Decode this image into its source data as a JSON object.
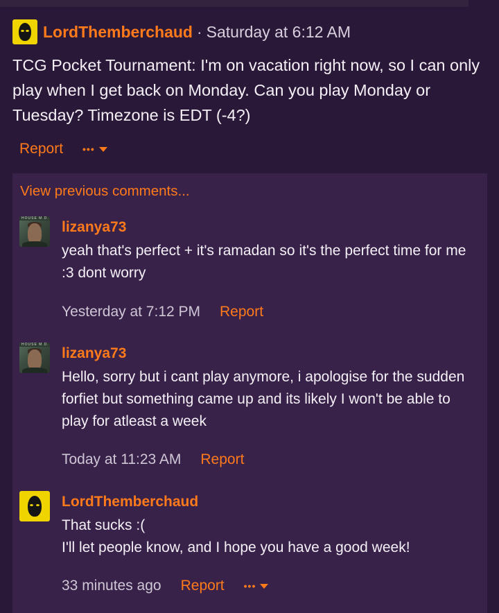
{
  "post": {
    "username": "LordThemberchaud",
    "separator": "·",
    "timestamp": "Saturday at 6:12 AM",
    "body": "TCG Pocket Tournament: I'm on vacation right now, so I can only play when I get back on Monday. Can you play Monday or Tuesday? Timezone is EDT (-4?)",
    "report_label": "Report",
    "more_label": "•••"
  },
  "comments": {
    "view_previous": "View previous comments...",
    "items": [
      {
        "username": "lizanya73",
        "text": "yeah that's perfect + it's ramadan so it's the perfect time for me :3 dont worry",
        "time": "Yesterday at 7:12 PM",
        "report_label": "Report",
        "avatar_tag": "HOUSE M.D."
      },
      {
        "username": "lizanya73",
        "text": "Hello, sorry but i cant play anymore, i apologise for the sudden forfiet but something came up and its likely I won't be able to play for atleast a week",
        "time": "Today at 11:23 AM",
        "report_label": "Report",
        "avatar_tag": "HOUSE M.D."
      },
      {
        "username": "LordThemberchaud",
        "text_line1": "That sucks :(",
        "text_line2": "I'll let people know, and I hope you have a good week!",
        "time": "33 minutes ago",
        "report_label": "Report",
        "more_label": "•••"
      }
    ]
  },
  "colors": {
    "background": "#2a1838",
    "panel": "#38224a",
    "accent": "#ff7a1a"
  },
  "icons": {
    "user_avatar": "yellow-mask-avatar",
    "commenter_avatar": "portrait-photo-avatar",
    "more_menu": "ellipsis-caret-icon"
  }
}
